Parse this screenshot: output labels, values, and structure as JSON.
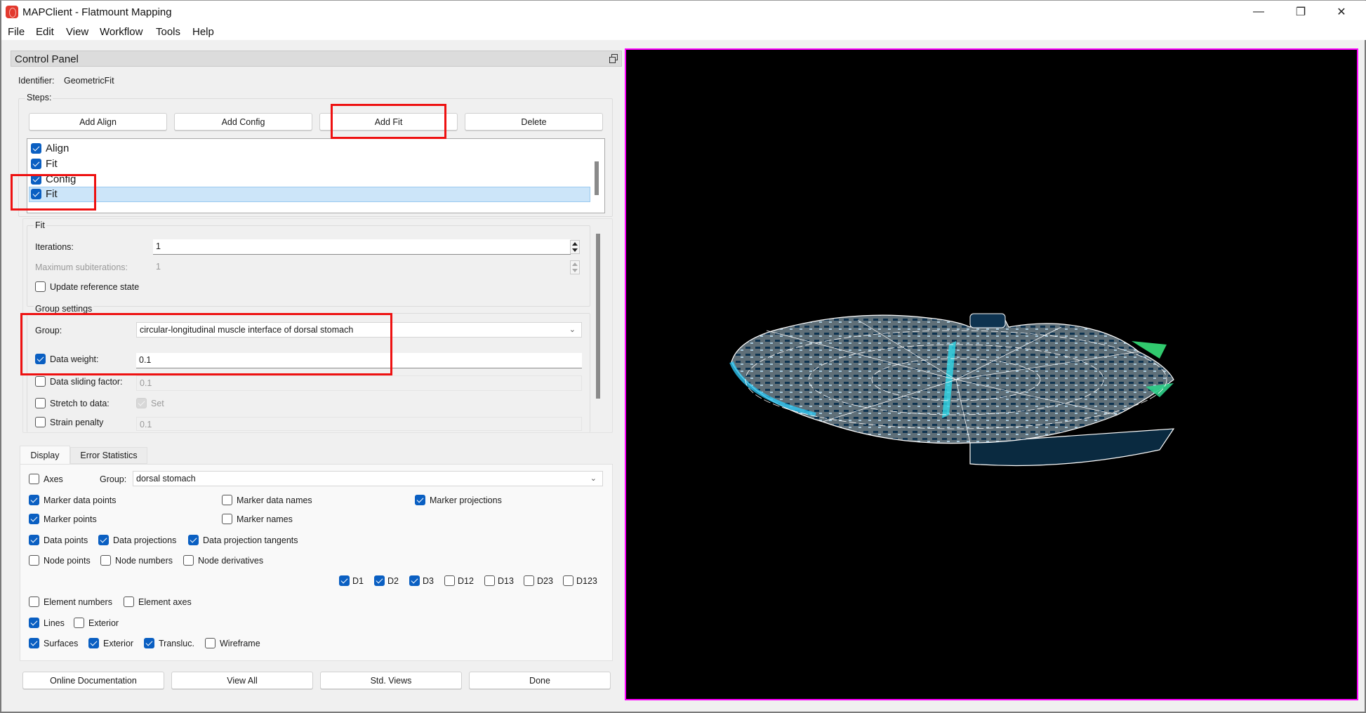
{
  "window": {
    "title": "MAPClient - Flatmount Mapping",
    "controls": {
      "minimize": "—",
      "restore": "❐",
      "close": "✕"
    }
  },
  "menu": [
    "File",
    "Edit",
    "View",
    "Workflow",
    "Tools",
    "Help"
  ],
  "control_panel": {
    "title": "Control Panel",
    "identifier_label": "Identifier:",
    "identifier_value": "GeometricFit",
    "steps_label": "Steps:",
    "step_buttons": [
      "Add Align",
      "Add Config",
      "Add Fit",
      "Delete"
    ],
    "steps": [
      {
        "label": "Align",
        "checked": true,
        "selected": false
      },
      {
        "label": "Fit",
        "checked": true,
        "selected": false
      },
      {
        "label": "Config",
        "checked": true,
        "selected": false
      },
      {
        "label": "Fit",
        "checked": true,
        "selected": true
      }
    ],
    "fit": {
      "title": "Fit",
      "iterations_label": "Iterations:",
      "iterations_value": "1",
      "max_subiterations_label": "Maximum subiterations:",
      "max_subiterations_value": "1",
      "update_reference_label": "Update reference state",
      "update_reference_checked": false
    },
    "group_settings": {
      "title": "Group settings",
      "group_label": "Group:",
      "group_value": "circular-longitudinal muscle interface of dorsal stomach",
      "data_weight_label": "Data weight:",
      "data_weight_checked": true,
      "data_weight_value": "0.1",
      "data_sliding_label": "Data sliding factor:",
      "data_sliding_checked": false,
      "data_sliding_value": "0.1",
      "stretch_label": "Stretch to data:",
      "stretch_checked": false,
      "stretch_set_label": "Set",
      "strain_label": "Strain penalty",
      "strain_checked": false,
      "strain_value": "0.1"
    },
    "tabs": [
      "Display",
      "Error Statistics"
    ],
    "active_tab": "Display",
    "display": {
      "axes_label": "Axes",
      "group_label": "Group:",
      "group_value": "dorsal stomach",
      "options": {
        "marker_data_points": {
          "label": "Marker data points",
          "checked": true
        },
        "marker_data_names": {
          "label": "Marker data names",
          "checked": false
        },
        "marker_projections": {
          "label": "Marker projections",
          "checked": true
        },
        "marker_points": {
          "label": "Marker points",
          "checked": true
        },
        "marker_names": {
          "label": "Marker names",
          "checked": false
        },
        "data_points": {
          "label": "Data points",
          "checked": true
        },
        "data_projections": {
          "label": "Data projections",
          "checked": true
        },
        "data_projection_tangents": {
          "label": "Data projection tangents",
          "checked": true
        },
        "node_points": {
          "label": "Node points",
          "checked": false
        },
        "node_numbers": {
          "label": "Node numbers",
          "checked": false
        },
        "node_derivatives": {
          "label": "Node derivatives",
          "checked": false
        },
        "element_numbers": {
          "label": "Element numbers",
          "checked": false
        },
        "element_axes": {
          "label": "Element axes",
          "checked": false
        },
        "lines": {
          "label": "Lines",
          "checked": true
        },
        "lines_exterior": {
          "label": "Exterior",
          "checked": false
        },
        "surfaces": {
          "label": "Surfaces",
          "checked": true
        },
        "surfaces_exterior": {
          "label": "Exterior",
          "checked": true
        },
        "transluc": {
          "label": "Transluc.",
          "checked": true
        },
        "wireframe": {
          "label": "Wireframe",
          "checked": false
        }
      },
      "derivatives": [
        {
          "label": "D1",
          "checked": true
        },
        {
          "label": "D2",
          "checked": true
        },
        {
          "label": "D3",
          "checked": true
        },
        {
          "label": "D12",
          "checked": false
        },
        {
          "label": "D13",
          "checked": false
        },
        {
          "label": "D23",
          "checked": false
        },
        {
          "label": "D123",
          "checked": false
        }
      ]
    },
    "bottom_buttons": [
      "Online Documentation",
      "View All",
      "Std. Views",
      "Done"
    ]
  },
  "colors": {
    "viewport_border": "#ff00ff",
    "highlight_box": "#ee1111",
    "checkbox_checked": "#0a5fc2",
    "selected_row": "#cce5f9"
  }
}
